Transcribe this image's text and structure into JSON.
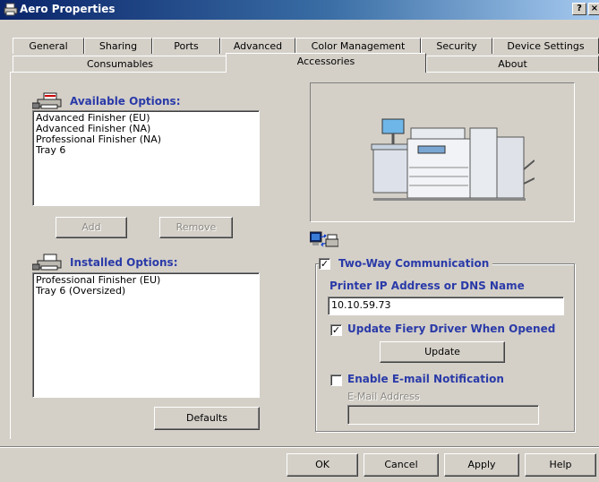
{
  "window": {
    "title": "Aero Properties",
    "help_btn": "?",
    "close_btn": "×"
  },
  "tabs_row1": [
    "General",
    "Sharing",
    "Ports",
    "Advanced",
    "Color Management",
    "Security",
    "Device Settings"
  ],
  "tabs_row2": [
    "Consumables",
    "Accessories",
    "About"
  ],
  "active_tab": "Accessories",
  "available": {
    "heading": "Available Options:",
    "items": [
      "Advanced Finisher (EU)",
      "Advanced Finisher (NA)",
      "Professional Finisher (NA)",
      "Tray 6"
    ]
  },
  "add_button": "Add",
  "remove_button": "Remove",
  "installed": {
    "heading": "Installed Options:",
    "items": [
      "Professional Finisher (EU)",
      "Tray 6 (Oversized)"
    ]
  },
  "defaults_button": "Defaults",
  "two_way": {
    "label": "Two-Way Communication",
    "checked": true,
    "ip_label": "Printer IP Address or DNS Name",
    "ip_value": "10.10.59.73",
    "update_fiery_label": "Update Fiery Driver When Opened",
    "update_fiery_checked": true,
    "update_button": "Update",
    "email_label": "Enable E-mail Notification",
    "email_checked": false,
    "email_address_label": "E-Mail Address",
    "email_address_value": ""
  },
  "footer": {
    "ok": "OK",
    "cancel": "Cancel",
    "apply": "Apply",
    "help": "Help"
  },
  "colors": {
    "face": "#d4d0c8",
    "heading": "#2a3aa8",
    "title_start": "#0a246a",
    "title_end": "#a6caf0"
  }
}
